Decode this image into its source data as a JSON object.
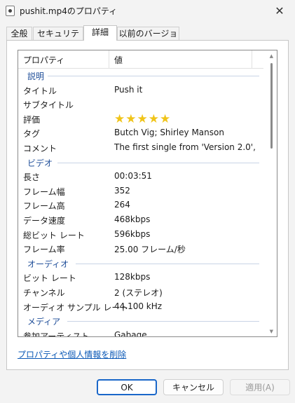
{
  "window": {
    "title": "pushit.mp4のプロパティ",
    "close_glyph": "✕",
    "file_icon": "video-file-icon"
  },
  "tabs": [
    {
      "label": "全般"
    },
    {
      "label": "セキュリティ"
    },
    {
      "label": "詳細"
    },
    {
      "label": "以前のバージョン"
    }
  ],
  "details": {
    "header": {
      "property": "プロパティ",
      "value": "値"
    },
    "groups": {
      "description": "説明",
      "video": "ビデオ",
      "audio": "オーディオ",
      "media": "メディア"
    },
    "rows": {
      "title": {
        "k": "タイトル",
        "v": "Push it"
      },
      "subtitle": {
        "k": "サブタイトル",
        "v": ""
      },
      "rating": {
        "k": "評価",
        "stars": 5,
        "glyph": "★★★★★"
      },
      "tags": {
        "k": "タグ",
        "v": "Butch Vig; Shirley Manson"
      },
      "comment": {
        "k": "コメント",
        "v": "The first single from 'Version 2.0',"
      },
      "length": {
        "k": "長さ",
        "v": "00:03:51"
      },
      "frame_width": {
        "k": "フレーム幅",
        "v": "352"
      },
      "frame_height": {
        "k": "フレーム高",
        "v": "264"
      },
      "data_rate": {
        "k": "データ速度",
        "v": "468kbps"
      },
      "total_bitrate": {
        "k": "総ビット レート",
        "v": "596kbps"
      },
      "frame_rate": {
        "k": "フレーム率",
        "v": "25.00 フレーム/秒"
      },
      "audio_bitrate": {
        "k": "ビット レート",
        "v": "128kbps"
      },
      "channels": {
        "k": "チャンネル",
        "v": "2 (ステレオ)"
      },
      "sample_rate": {
        "k": "オーディオ サンプル レート",
        "v": "44.100 kHz"
      },
      "contributing_artist": {
        "k": "参加アーティスト",
        "v": "Gabage"
      }
    }
  },
  "links": {
    "remove_properties": "プロパティや個人情報を削除"
  },
  "buttons": {
    "ok": "OK",
    "cancel": "キャンセル",
    "apply": "適用(A)"
  },
  "colors": {
    "accent": "#1a67c9",
    "link": "#0a58b6",
    "group_label": "#1f4e99",
    "star": "#f0c419"
  }
}
